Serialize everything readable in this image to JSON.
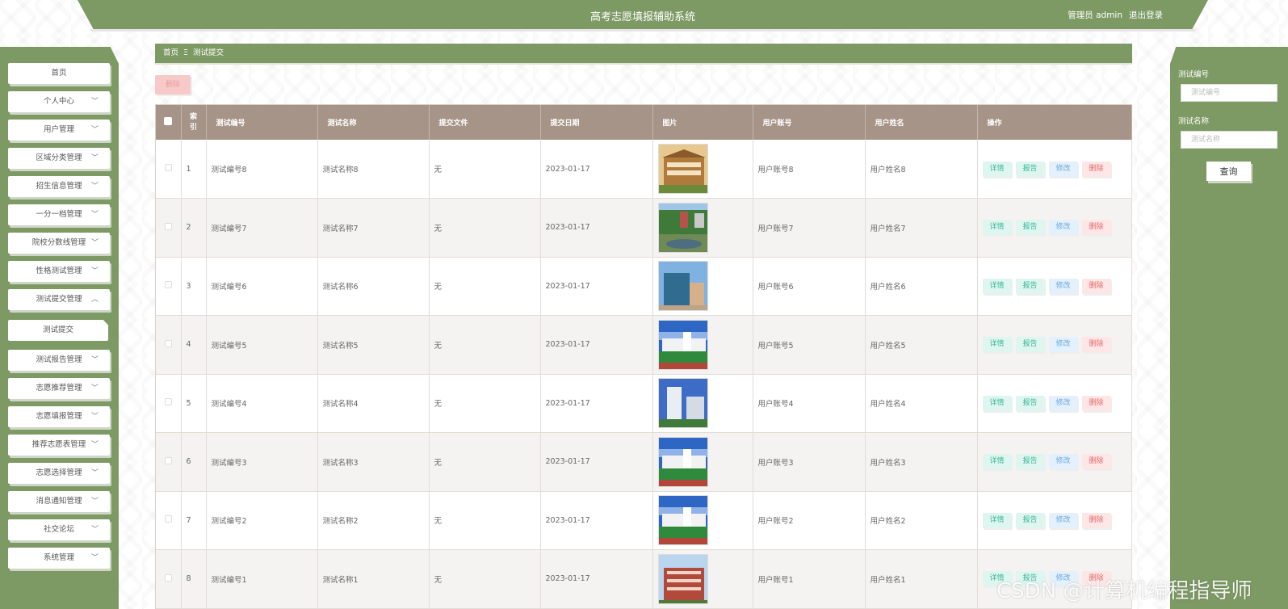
{
  "header": {
    "title": "高考志愿填报辅助系统",
    "user_role": "管理员",
    "user_name": "admin",
    "logout": "退出登录"
  },
  "sidebar": {
    "items": [
      {
        "label": "首页",
        "has_chevron": false
      },
      {
        "label": "个人中心",
        "has_chevron": true,
        "chevron": "down"
      },
      {
        "label": "用户管理",
        "has_chevron": true,
        "chevron": "down"
      },
      {
        "label": "区域分类管理",
        "has_chevron": true,
        "chevron": "down"
      },
      {
        "label": "招生信息管理",
        "has_chevron": true,
        "chevron": "down"
      },
      {
        "label": "一分一档管理",
        "has_chevron": true,
        "chevron": "down"
      },
      {
        "label": "院校分数线管理",
        "has_chevron": true,
        "chevron": "down"
      },
      {
        "label": "性格测试管理",
        "has_chevron": true,
        "chevron": "down"
      },
      {
        "label": "测试提交管理",
        "has_chevron": true,
        "chevron": "up"
      },
      {
        "label": "测试提交",
        "sub": true
      },
      {
        "label": "测试报告管理",
        "has_chevron": true,
        "chevron": "down"
      },
      {
        "label": "志愿推荐管理",
        "has_chevron": true,
        "chevron": "down"
      },
      {
        "label": "志愿填报管理",
        "has_chevron": true,
        "chevron": "down"
      },
      {
        "label": "推荐志愿表管理",
        "has_chevron": true,
        "chevron": "down"
      },
      {
        "label": "志愿选择管理",
        "has_chevron": true,
        "chevron": "down"
      },
      {
        "label": "消息通知管理",
        "has_chevron": true,
        "chevron": "down"
      },
      {
        "label": "社交论坛",
        "has_chevron": true,
        "chevron": "down"
      },
      {
        "label": "系统管理",
        "has_chevron": true,
        "chevron": "down"
      }
    ]
  },
  "breadcrumb": {
    "home": "首页",
    "separator": "Ξ",
    "current": "测试提交"
  },
  "toolbar": {
    "delete_label": "删除"
  },
  "search": {
    "field1_label": "测试编号",
    "field1_placeholder": "测试编号",
    "field2_label": "测试名称",
    "field2_placeholder": "测试名称",
    "button": "查询"
  },
  "table": {
    "headers": [
      "索引",
      "测试编号",
      "测试名称",
      "提交文件",
      "提交日期",
      "图片",
      "用户账号",
      "用户姓名",
      "操作"
    ],
    "index_header_line1": "索",
    "index_header_line2": "引",
    "actions": {
      "detail": "详情",
      "report": "报告",
      "edit": "修改",
      "remove": "删除"
    },
    "rows": [
      {
        "index": "1",
        "code": "测试编号8",
        "name": "测试名称8",
        "file": "无",
        "date": "2023-01-17",
        "account": "用户账号8",
        "username": "用户姓名8",
        "image": "brown-building"
      },
      {
        "index": "2",
        "code": "测试编号7",
        "name": "测试名称7",
        "file": "无",
        "date": "2023-01-17",
        "account": "用户账号7",
        "username": "用户姓名7",
        "image": "campus-pond"
      },
      {
        "index": "3",
        "code": "测试编号6",
        "name": "测试名称6",
        "file": "无",
        "date": "2023-01-17",
        "account": "用户账号6",
        "username": "用户姓名6",
        "image": "glass-building"
      },
      {
        "index": "4",
        "code": "测试编号5",
        "name": "测试名称5",
        "file": "无",
        "date": "2023-01-17",
        "account": "用户账号5",
        "username": "用户姓名5",
        "image": "white-building-field"
      },
      {
        "index": "5",
        "code": "测试编号4",
        "name": "测试名称4",
        "file": "无",
        "date": "2023-01-17",
        "account": "用户账号4",
        "username": "用户姓名4",
        "image": "white-tower"
      },
      {
        "index": "6",
        "code": "测试编号3",
        "name": "测试名称3",
        "file": "无",
        "date": "2023-01-17",
        "account": "用户账号3",
        "username": "用户姓名3",
        "image": "white-building-field"
      },
      {
        "index": "7",
        "code": "测试编号2",
        "name": "测试名称2",
        "file": "无",
        "date": "2023-01-17",
        "account": "用户账号2",
        "username": "用户姓名2",
        "image": "white-building-field"
      },
      {
        "index": "8",
        "code": "测试编号1",
        "name": "测试名称1",
        "file": "无",
        "date": "2023-01-17",
        "account": "用户账号1",
        "username": "用户姓名1",
        "image": "red-building"
      }
    ]
  },
  "watermark": "CSDN @计算机编程指导师",
  "colors": {
    "accent_green": "#7d9a64",
    "table_header": "#a69488",
    "detail": "#3bb79b",
    "edit": "#6aa9dc",
    "remove": "#e46b6b"
  }
}
